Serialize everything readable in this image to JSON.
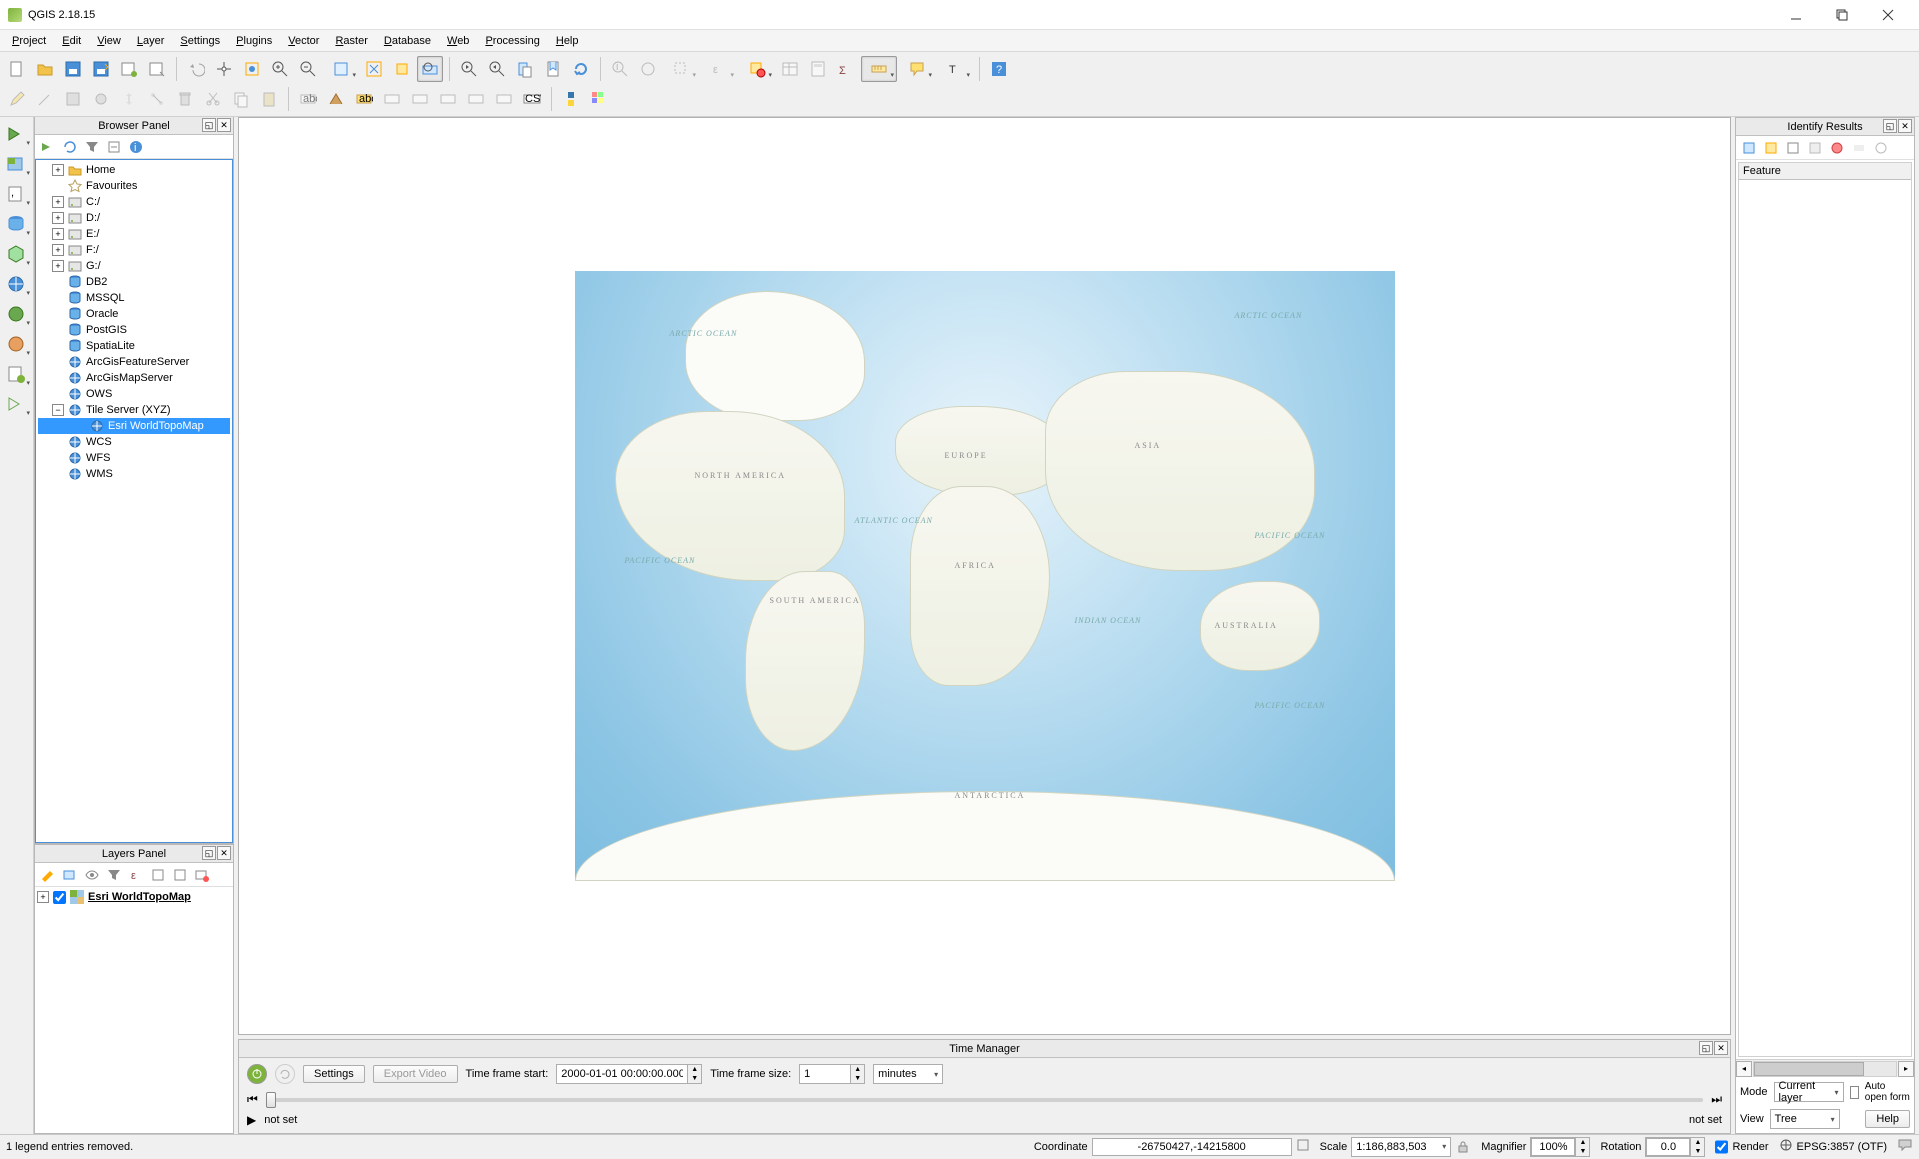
{
  "window": {
    "title": "QGIS 2.18.15"
  },
  "menu": [
    "Project",
    "Edit",
    "View",
    "Layer",
    "Settings",
    "Plugins",
    "Vector",
    "Raster",
    "Database",
    "Web",
    "Processing",
    "Help"
  ],
  "panels": {
    "browser": {
      "title": "Browser Panel",
      "items": [
        {
          "label": "Home",
          "icon": "folder",
          "exp": true
        },
        {
          "label": "Favourites",
          "icon": "star",
          "exp": false
        },
        {
          "label": "C:/",
          "icon": "disk",
          "exp": true
        },
        {
          "label": "D:/",
          "icon": "disk",
          "exp": true
        },
        {
          "label": "E:/",
          "icon": "disk",
          "exp": true
        },
        {
          "label": "F:/",
          "icon": "disk",
          "exp": true
        },
        {
          "label": "G:/",
          "icon": "disk",
          "exp": true
        },
        {
          "label": "DB2",
          "icon": "db",
          "exp": false
        },
        {
          "label": "MSSQL",
          "icon": "db",
          "exp": false
        },
        {
          "label": "Oracle",
          "icon": "db",
          "exp": false
        },
        {
          "label": "PostGIS",
          "icon": "db",
          "exp": false
        },
        {
          "label": "SpatiaLite",
          "icon": "db",
          "exp": false
        },
        {
          "label": "ArcGisFeatureServer",
          "icon": "globe",
          "exp": false
        },
        {
          "label": "ArcGisMapServer",
          "icon": "globe",
          "exp": false
        },
        {
          "label": "OWS",
          "icon": "globe",
          "exp": false
        },
        {
          "label": "Tile Server (XYZ)",
          "icon": "globe",
          "exp": true,
          "expanded": true,
          "children": [
            {
              "label": "Esri WorldTopoMap",
              "icon": "globe",
              "selected": true
            }
          ]
        },
        {
          "label": "WCS",
          "icon": "globe",
          "exp": false
        },
        {
          "label": "WFS",
          "icon": "globe",
          "exp": false
        },
        {
          "label": "WMS",
          "icon": "globe",
          "exp": false
        }
      ]
    },
    "layers": {
      "title": "Layers Panel",
      "items": [
        {
          "label": "Esri WorldTopoMap",
          "checked": true
        }
      ]
    },
    "identify": {
      "title": "Identify Results",
      "feature_header": "Feature",
      "mode_label": "Mode",
      "mode_value": "Current layer",
      "auto_open_label": "Auto open form",
      "view_label": "View",
      "view_value": "Tree",
      "help_label": "Help"
    }
  },
  "time_manager": {
    "title": "Time Manager",
    "settings_btn": "Settings",
    "export_btn": "Export Video",
    "frame_start_label": "Time frame start:",
    "frame_start_value": "2000-01-01 00:00:00.000",
    "frame_size_label": "Time frame size:",
    "frame_size_value": "1",
    "frame_size_unit": "minutes",
    "not_set_left": "not set",
    "not_set_right": "not set"
  },
  "statusbar": {
    "message": "1 legend entries removed.",
    "coord_label": "Coordinate",
    "coord_value": "-26750427,-14215800",
    "scale_label": "Scale",
    "scale_value": "1:186,883,503",
    "magnifier_label": "Magnifier",
    "magnifier_value": "100%",
    "rotation_label": "Rotation",
    "rotation_value": "0.0",
    "render_label": "Render",
    "crs_label": "EPSG:3857 (OTF)"
  },
  "map_labels": {
    "arctic1": "Arctic Ocean",
    "arctic2": "Arctic Ocean",
    "na": "NORTH AMERICA",
    "eu": "EUROPE",
    "as": "ASIA",
    "atl": "Atlantic Ocean",
    "af": "AFRICA",
    "pac1": "Pacific Ocean",
    "pac2": "Pacific Ocean",
    "pac3": "Pacific Ocean",
    "sa": "SOUTH AMERICA",
    "ind": "Indian Ocean",
    "au": "AUSTRALIA",
    "ant": "ANTARCTICA"
  }
}
